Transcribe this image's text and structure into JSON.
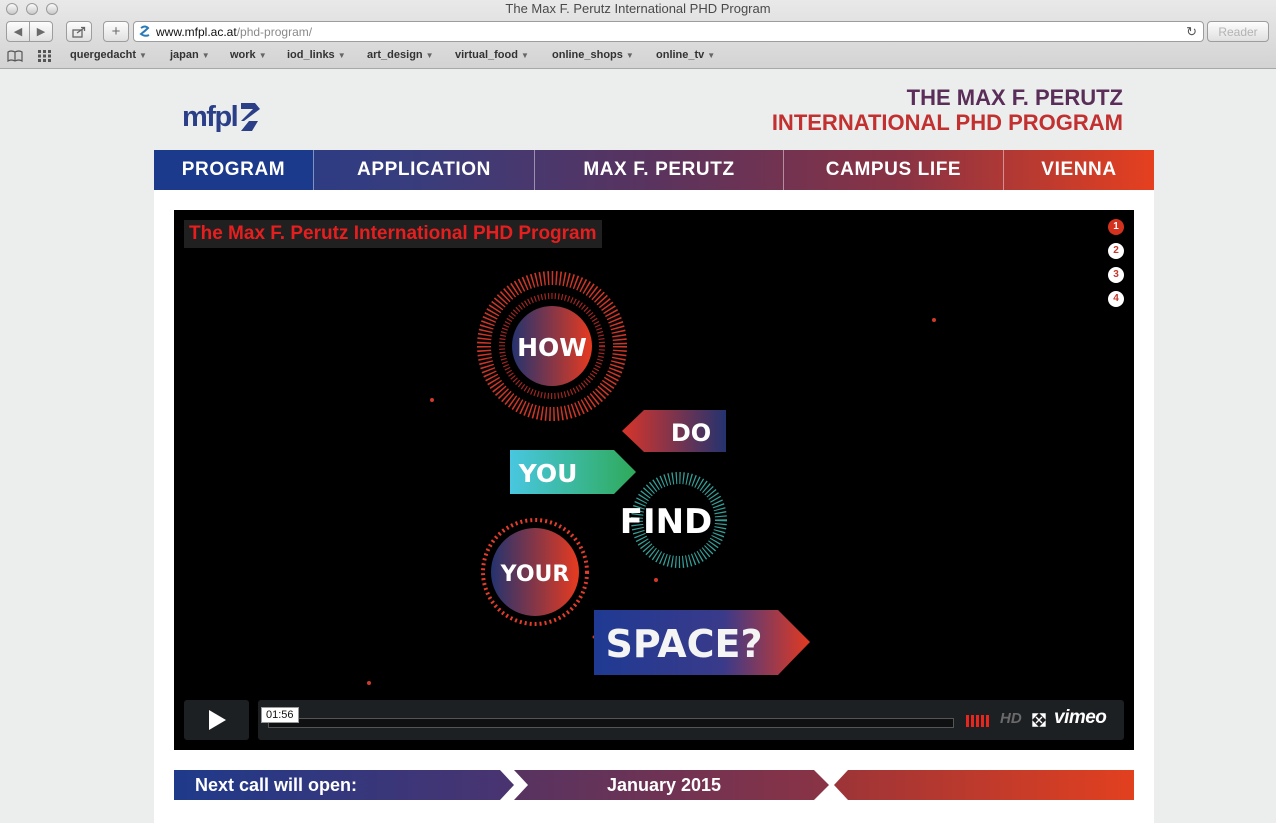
{
  "window": {
    "title": "The Max F. Perutz International PHD Program"
  },
  "toolbar": {
    "url_domain": "www.mfpl.ac.at",
    "url_path": "/phd-program/",
    "reader_label": "Reader"
  },
  "bookmarks": [
    {
      "label": "quergedacht"
    },
    {
      "label": "japan"
    },
    {
      "label": "work"
    },
    {
      "label": "iod_links"
    },
    {
      "label": "art_design"
    },
    {
      "label": "virtual_food"
    },
    {
      "label": "online_shops"
    },
    {
      "label": "online_tv"
    }
  ],
  "site": {
    "logo_text": "mfpl",
    "title_line1": "THE MAX F. PERUTZ",
    "title_line2": "INTERNATIONAL PHD PROGRAM"
  },
  "nav": [
    {
      "label": "PROGRAM"
    },
    {
      "label": "APPLICATION"
    },
    {
      "label": "MAX F. PERUTZ"
    },
    {
      "label": "CAMPUS LIFE"
    },
    {
      "label": "VIENNA"
    }
  ],
  "video": {
    "title": "The Max F. Perutz International PHD Program",
    "slides": [
      "1",
      "2",
      "3",
      "4"
    ],
    "active_slide": "1",
    "words": [
      "HOW",
      "DO",
      "YOU",
      "FIND",
      "YOUR",
      "SPACE?"
    ],
    "time": "01:56",
    "hd_label": "HD",
    "brand": "vimeo",
    "progress": 0
  },
  "banner": {
    "label": "Next call will open:",
    "date": "January 2015"
  },
  "colors": {
    "brand_blue": "#1e3a8a",
    "brand_purple": "#5a335e",
    "brand_red": "#e5401f"
  }
}
